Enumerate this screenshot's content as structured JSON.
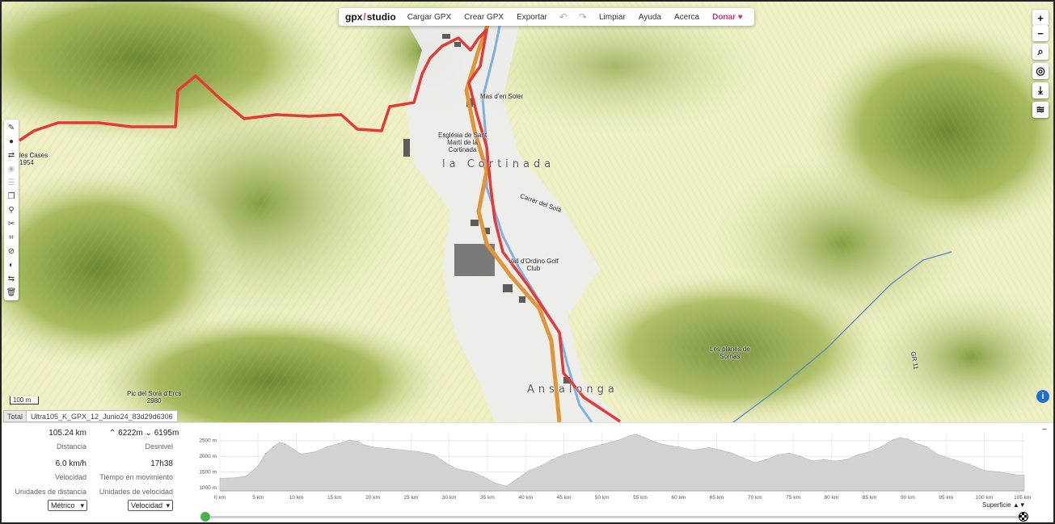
{
  "toolbar": {
    "logo_left": "gpx",
    "logo_right": "studio",
    "load": "Cargar GPX",
    "create": "Crear GPX",
    "export": "Exportar",
    "undo_icon": "undo-icon",
    "redo_icon": "redo-icon",
    "clear": "Limpiar",
    "help": "Ayuda",
    "about": "Acerca",
    "donate": "Donar",
    "donate_icon": "heart-icon"
  },
  "map_labels": {
    "mas_den_soler": "Mas d'en Soler",
    "esglesia": [
      "Església de Sant",
      "Martí de la",
      "Cortinada"
    ],
    "la_cortinada": "la Cortinada",
    "golf": [
      "Vall d'Ordino Golf",
      "Club"
    ],
    "planes": [
      "Les planes de",
      "Sornas"
    ],
    "pic": [
      "Pic del Sorà d'Ercs",
      "2980"
    ],
    "arans": "Ansalonga",
    "cases": [
      "les Cases",
      "1954"
    ],
    "gr": "GR 11",
    "street": "Carrer del Solà"
  },
  "map_controls": {
    "zoom_in": "+",
    "zoom_out": "−",
    "search_icon": "search-icon",
    "locate_icon": "locate-icon",
    "download_icon": "download-icon",
    "layers_icon": "layers-icon",
    "info": "i",
    "scale": "100 m"
  },
  "left_tools": [
    "pencil-icon",
    "drop-icon",
    "reverse-icon",
    "merge-icon",
    "list-icon",
    "copy-icon",
    "pin-icon",
    "scissors-icon",
    "crop-icon",
    "hide-icon",
    "palette-icon",
    "split-icon",
    "trash-icon"
  ],
  "tabs": {
    "total": "Total",
    "file": "Ultra105_K_GPX_12_Junio24_83d29d6306"
  },
  "stats": {
    "distance_value": "105.24 km",
    "distance_label": "Distancia",
    "elevation_up": "6222m",
    "elevation_down": "6195m",
    "elevation_label": "Desnivel",
    "speed_value": "6.0 km/h",
    "speed_label": "Velocidad",
    "moving_time_value": "17h38",
    "moving_time_label": "Tiempo en movimiento",
    "distance_units_label": "Unidades de distancia",
    "speed_units_label": "Unidades de velocidad",
    "distance_units_select": "Métrico",
    "speed_units_select": "Velocidad"
  },
  "chart_data": {
    "type": "area",
    "x_unit": "km",
    "x_ticks": [
      "0 km",
      "5 km",
      "10 km",
      "15 km",
      "20 km",
      "25 km",
      "30 km",
      "35 km",
      "40 km",
      "45 km",
      "50 km",
      "55 km",
      "60 km",
      "65 km",
      "70 km",
      "75 km",
      "80 km",
      "85 km",
      "90 km",
      "95 km",
      "100 km",
      "105 km"
    ],
    "y_ticks": [
      "1000 m",
      "1500 m",
      "2000 m",
      "2500 m"
    ],
    "ylim": [
      900,
      2750
    ],
    "xlim": [
      0,
      105.24
    ],
    "x": [
      0,
      2,
      3.5,
      5,
      6,
      7,
      7.8,
      8.5,
      9.5,
      10.5,
      11.5,
      12.5,
      14,
      15.5,
      17,
      18,
      19,
      20.5,
      22,
      24,
      26,
      28,
      29.5,
      31,
      33,
      34.5,
      36,
      37.5,
      39,
      40.5,
      42,
      43.5,
      45,
      46.5,
      48,
      50,
      52,
      53.5,
      54.5,
      55.5,
      57,
      58.5,
      60,
      62,
      64,
      65.5,
      67,
      68.5,
      70,
      71.5,
      73,
      74.5,
      76,
      77.5,
      79,
      80.5,
      82,
      83.5,
      85,
      86.5,
      88,
      89,
      90,
      91,
      92.5,
      94,
      96,
      98,
      100,
      102,
      104,
      105.24
    ],
    "y": [
      1300,
      1320,
      1380,
      1700,
      2100,
      2300,
      2450,
      2400,
      2250,
      2080,
      2100,
      2150,
      2300,
      2400,
      2520,
      2480,
      2350,
      2280,
      2250,
      2200,
      2150,
      2050,
      1800,
      1600,
      1500,
      1350,
      1150,
      1050,
      1300,
      1550,
      1700,
      1900,
      2050,
      2150,
      2250,
      2380,
      2500,
      2650,
      2700,
      2600,
      2450,
      2350,
      2300,
      2200,
      2280,
      2200,
      2100,
      1950,
      1800,
      1900,
      2050,
      2100,
      2000,
      1850,
      1900,
      1850,
      1900,
      2050,
      2150,
      2300,
      2520,
      2600,
      2550,
      2420,
      2300,
      2050,
      1900,
      1750,
      1550,
      1500,
      1420,
      1400
    ],
    "xlabel": "",
    "ylabel": "",
    "surface_label": "Superficie"
  },
  "colors": {
    "track": "#e53935",
    "road": "#f0a030",
    "river": "#6fa8dc",
    "profile_fill": "#d2d2d2",
    "slider_start": "#4caf50",
    "donate": "#d62f7c"
  }
}
